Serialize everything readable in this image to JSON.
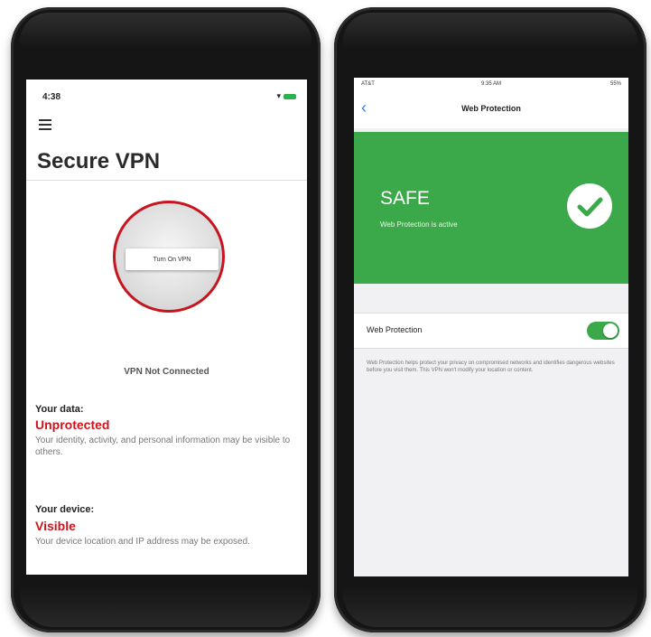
{
  "left_phone": {
    "status_time": "4:38",
    "app_title": "Secure VPN",
    "vpn_button_label": "Turn On VPN",
    "vpn_status": "VPN Not Connected",
    "data_section": {
      "label": "Your data:",
      "value": "Unprotected",
      "description": "Your identity, activity, and personal information may be visible to others."
    },
    "device_section": {
      "label": "Your device:",
      "value": "Visible",
      "description": "Your device location and IP address may be exposed."
    }
  },
  "right_phone": {
    "status_carrier": "AT&T",
    "status_time": "9:35 AM",
    "status_battery": "55%",
    "nav_title": "Web Protection",
    "banner_title": "SAFE",
    "banner_subtitle": "Web Protection is active",
    "toggle_label": "Web Protection",
    "toggle_on": true,
    "description": "Web Protection helps protect your privacy on compromised networks and identifies dangerous websites before you visit them. This VPN won't modify your location or content."
  },
  "colors": {
    "accent_red": "#c8141f",
    "safe_green": "#3ba84a",
    "ios_blue": "#2f7de1"
  }
}
